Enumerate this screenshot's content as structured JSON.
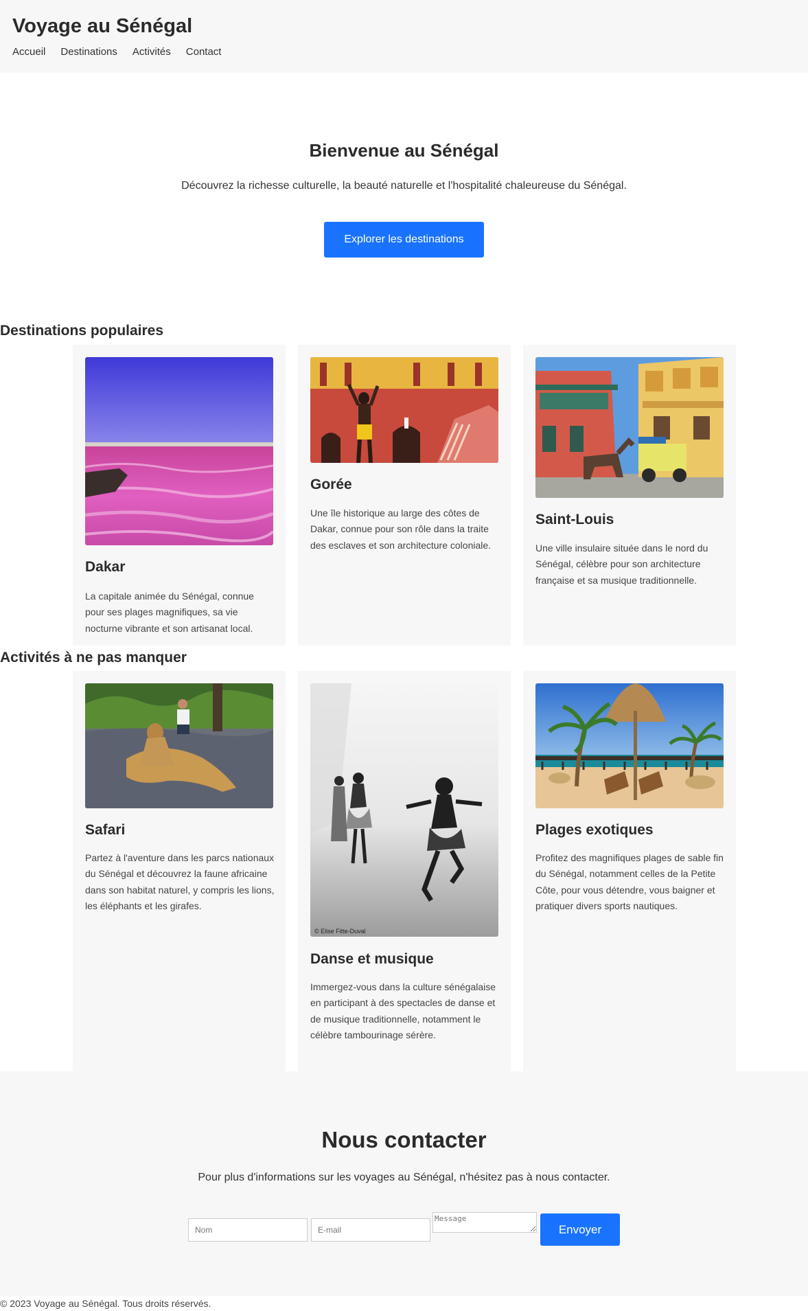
{
  "header": {
    "site_title": "Voyage au Sénégal",
    "nav": [
      "Accueil",
      "Destinations",
      "Activités",
      "Contact"
    ]
  },
  "hero": {
    "title": "Bienvenue au Sénégal",
    "text": "Découvrez la richesse culturelle, la beauté naturelle et l'hospitalité chaleureuse du Sénégal.",
    "button_label": "Explorer les destinations"
  },
  "destinations": {
    "title": "Destinations populaires",
    "cards": [
      {
        "name": "Dakar",
        "description": "La capitale animée du Sénégal, connue pour ses plages magnifiques, sa vie nocturne vibrante et son artisanat local."
      },
      {
        "name": "Gorée",
        "description": "Une île historique au large des côtes de Dakar, connue pour son rôle dans la traite des esclaves et son architecture coloniale."
      },
      {
        "name": "Saint-Louis",
        "description": "Une ville insulaire située dans le nord du Sénégal, célèbre pour son architecture française et sa musique traditionnelle."
      }
    ]
  },
  "activities": {
    "title": "Activités à ne pas manquer",
    "cards": [
      {
        "name": "Safari",
        "description": "Partez à l'aventure dans les parcs nationaux du Sénégal et découvrez la faune africaine dans son habitat naturel, y compris les lions, les éléphants et les girafes."
      },
      {
        "name": "Danse et musique",
        "description": "Immergez-vous dans la culture sénégalaise en participant à des spectacles de danse et de musique traditionnelle, notamment le célèbre tambourinage sérère.",
        "photo_credit": "© Elise Fitte-Duval"
      },
      {
        "name": "Plages exotiques",
        "description": "Profitez des magnifiques plages de sable fin du Sénégal, notamment celles de la Petite Côte, pour vous détendre, vous baigner et pratiquer divers sports nautiques."
      }
    ]
  },
  "contact": {
    "title": "Nous contacter",
    "text": "Pour plus d'informations sur les voyages au Sénégal, n'hésitez pas à nous contacter.",
    "name_placeholder": "Nom",
    "email_placeholder": "E-mail",
    "message_placeholder": "Message",
    "send_label": "Envoyer"
  },
  "footer": {
    "copyright": "© 2023 Voyage au Sénégal. Tous droits réservés."
  }
}
